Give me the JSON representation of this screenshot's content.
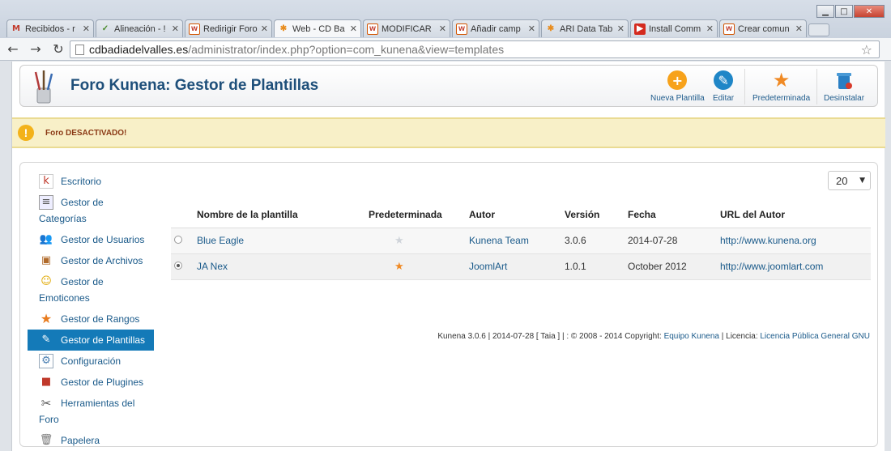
{
  "browser": {
    "tabs": [
      {
        "title": "Recibidos - r",
        "icon": "gmail-icon",
        "active": false
      },
      {
        "title": "Alineación - !",
        "icon": "alignment-icon",
        "active": false
      },
      {
        "title": "Redirigir Foro",
        "icon": "w-icon",
        "active": false
      },
      {
        "title": "Web - CD Ba",
        "icon": "joomla-icon",
        "active": true
      },
      {
        "title": "MODIFICAR",
        "icon": "w-icon",
        "active": false
      },
      {
        "title": "Añadir camp",
        "icon": "w-icon",
        "active": false
      },
      {
        "title": "ARI Data Tab",
        "icon": "joomla-icon",
        "active": false
      },
      {
        "title": "Install Comm",
        "icon": "youtube-icon",
        "active": false
      },
      {
        "title": "Crear comun",
        "icon": "w-icon",
        "active": false
      }
    ],
    "url_host": "cdbadiadelvalles.es",
    "url_path": "/administrator/index.php?option=com_kunena&view=templates"
  },
  "header": {
    "title": "Foro Kunena: Gestor de Plantillas",
    "buttons": {
      "new": "Nueva Plantilla",
      "edit": "Editar",
      "default": "Predeterminada",
      "uninstall": "Desinstalar"
    }
  },
  "alert": {
    "message": "Foro DESACTIVADO!"
  },
  "sidebar": {
    "items": [
      {
        "label": "Escritorio",
        "icon": "dashboard-icon"
      },
      {
        "label": "Gestor de Categorías",
        "icon": "categories-icon"
      },
      {
        "label": "Gestor de Usuarios",
        "icon": "users-icon"
      },
      {
        "label": "Gestor de Archivos",
        "icon": "files-icon"
      },
      {
        "label": "Gestor de Emoticones",
        "icon": "smiley-icon"
      },
      {
        "label": "Gestor de Rangos",
        "icon": "ranks-star-icon"
      },
      {
        "label": "Gestor de Plantillas",
        "icon": "templates-icon"
      },
      {
        "label": "Configuración",
        "icon": "config-icon"
      },
      {
        "label": "Gestor de Plugines",
        "icon": "plugins-icon"
      },
      {
        "label": "Herramientas del Foro",
        "icon": "tools-icon"
      },
      {
        "label": "Papelera",
        "icon": "trash-icon"
      }
    ]
  },
  "pager": {
    "per_page": "20"
  },
  "table": {
    "headers": {
      "name": "Nombre de la plantilla",
      "default": "Predeterminada",
      "author": "Autor",
      "version": "Versión",
      "date": "Fecha",
      "url": "URL del Autor"
    },
    "rows": [
      {
        "name": "Blue Eagle",
        "author": "Kunena Team",
        "version": "3.0.6",
        "date": "2014-07-28",
        "url": "http://www.kunena.org",
        "selected": false,
        "is_default": false
      },
      {
        "name": "JA Nex",
        "author": "JoomlArt",
        "version": "1.0.1",
        "date": "October 2012",
        "url": "http://www.joomlart.com",
        "selected": true,
        "is_default": true
      }
    ]
  },
  "footer": {
    "text": "Kunena 3.0.6 | 2014-07-28 [ Taia ] | : © 2008 - 2014 Copyright:",
    "team_link": "Equipo Kunena",
    "license_label": "| Licencia:",
    "license_link": "Licencia Pública General GNU"
  },
  "colors": {
    "title": "#1e4f7a",
    "link": "#1a5a8a",
    "active_sidebar": "#147ab8",
    "alert_bg": "#f8f0c8",
    "alert_text": "#8b3a16",
    "new_button": "#f7a21b",
    "edit_button": "#1f86c7",
    "default_star": "#f08a24"
  }
}
